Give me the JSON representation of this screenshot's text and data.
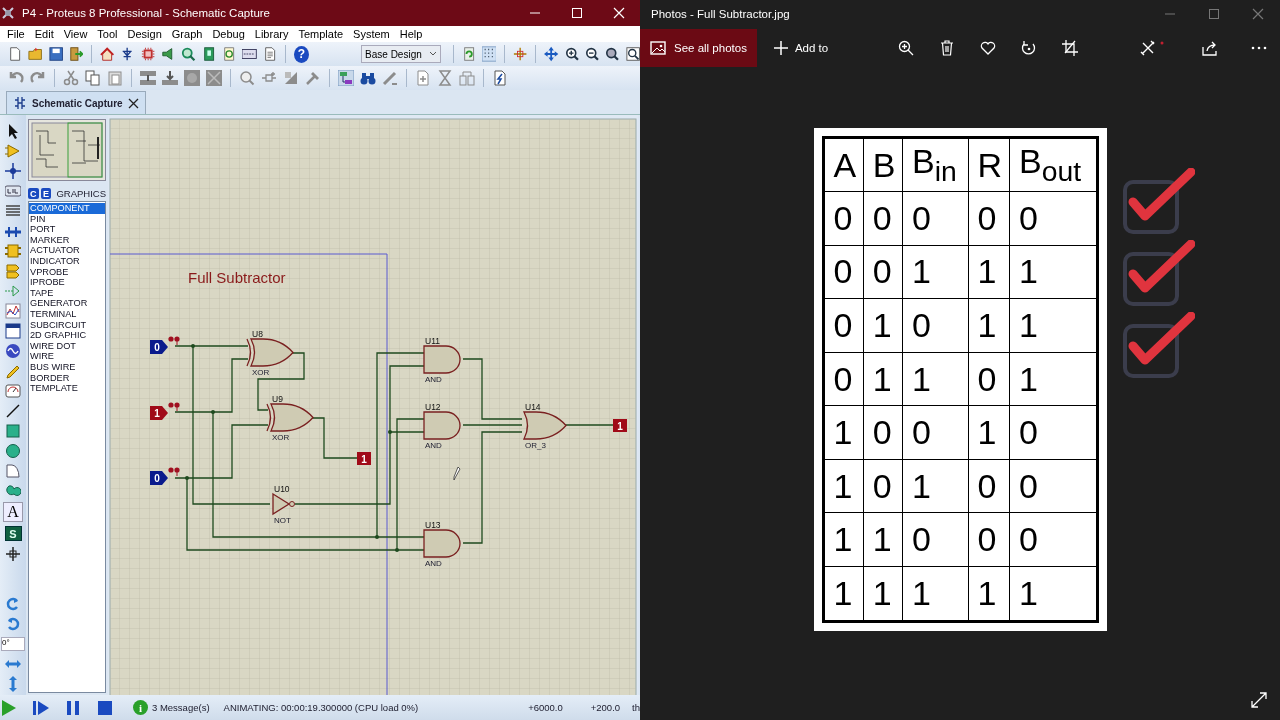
{
  "proteus": {
    "window": {
      "title": "P4 - Proteus 8 Professional - Schematic Capture"
    },
    "menu": [
      "File",
      "Edit",
      "View",
      "Tool",
      "Design",
      "Graph",
      "Debug",
      "Library",
      "Template",
      "System",
      "Help"
    ],
    "toolbar": {
      "help": "?",
      "design_select": "Base Design"
    },
    "tabs": [
      {
        "label": "Schematic Capture",
        "selected": true
      }
    ],
    "mode_tools": {
      "text_tool": "A",
      "symbol_tool": "S",
      "rotation": "0°"
    },
    "object_selector": {
      "buttons": [
        "C",
        "E"
      ],
      "title": "GRAPHICS",
      "items": [
        {
          "label": "COMPONENT",
          "selected": true
        },
        {
          "label": "PIN",
          "selected": false
        },
        {
          "label": "PORT",
          "selected": false
        },
        {
          "label": "MARKER",
          "selected": false
        },
        {
          "label": "ACTUATOR",
          "selected": false
        },
        {
          "label": "INDICATOR",
          "selected": false
        },
        {
          "label": "VPROBE",
          "selected": false
        },
        {
          "label": "IPROBE",
          "selected": false
        },
        {
          "label": "TAPE",
          "selected": false
        },
        {
          "label": "GENERATOR",
          "selected": false
        },
        {
          "label": "TERMINAL",
          "selected": false
        },
        {
          "label": "SUBCIRCUIT",
          "selected": false
        },
        {
          "label": "2D GRAPHIC",
          "selected": false
        },
        {
          "label": "WIRE DOT",
          "selected": false
        },
        {
          "label": "WIRE",
          "selected": false
        },
        {
          "label": "BUS WIRE",
          "selected": false
        },
        {
          "label": "BORDER",
          "selected": false
        },
        {
          "label": "TEMPLATE",
          "selected": false
        }
      ]
    },
    "schematic": {
      "title": "Full Subtractor",
      "terminals": [
        {
          "kind": "input",
          "text": "0",
          "color": "#0a1a8c"
        },
        {
          "kind": "input",
          "text": "1",
          "color": "#a00a18"
        },
        {
          "kind": "input",
          "text": "0",
          "color": "#0a1a8c"
        },
        {
          "kind": "output",
          "text": "1",
          "color": "#a00a18"
        },
        {
          "kind": "output",
          "text": "1",
          "color": "#a00a18"
        }
      ],
      "gates": [
        {
          "kind": "xor",
          "ref": "U8",
          "type": "XOR"
        },
        {
          "kind": "xor",
          "ref": "U9",
          "type": "XOR"
        },
        {
          "kind": "not",
          "ref": "U10",
          "type": "NOT"
        },
        {
          "kind": "and",
          "ref": "U11",
          "type": "AND"
        },
        {
          "kind": "and",
          "ref": "U12",
          "type": "AND"
        },
        {
          "kind": "and",
          "ref": "U13",
          "type": "AND"
        },
        {
          "kind": "or",
          "ref": "U14",
          "type": "OR_3"
        }
      ]
    },
    "status_bar": {
      "info": "i",
      "messages": "3 Message(s)",
      "status": "ANIMATING: 00:00:19.300000 (CPU load 0%)",
      "x": "+6000.0",
      "y": "+200.0",
      "unit": "th"
    }
  },
  "photos": {
    "window": {
      "title": "Photos - Full Subtractor.jpg"
    },
    "toolbar": {
      "see_all": "See all photos",
      "add_to": "Add to"
    },
    "table": {
      "columns": [
        "A",
        "B",
        "B$_{in}$",
        "R",
        "B$_{out}$"
      ],
      "rows": [
        [
          "0",
          "0",
          "0",
          "0",
          "0"
        ],
        [
          "0",
          "0",
          "1",
          "1",
          "1"
        ],
        [
          "0",
          "1",
          "0",
          "1",
          "1"
        ],
        [
          "0",
          "1",
          "1",
          "0",
          "1"
        ],
        [
          "1",
          "0",
          "0",
          "1",
          "0"
        ],
        [
          "1",
          "0",
          "1",
          "0",
          "0"
        ],
        [
          "1",
          "1",
          "0",
          "0",
          "0"
        ],
        [
          "1",
          "1",
          "1",
          "1",
          "1"
        ]
      ]
    }
  }
}
